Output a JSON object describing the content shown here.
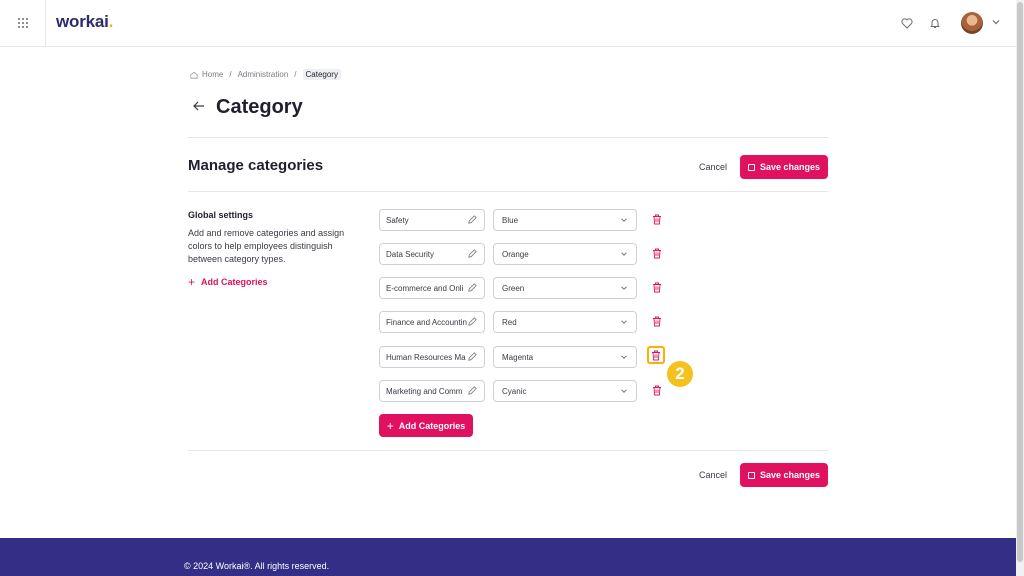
{
  "header": {
    "logo_text": "workai",
    "logo_dot": ".",
    "icons": [
      "apps-grid-icon",
      "heart-icon",
      "bell-icon",
      "avatar",
      "chevron-down-icon"
    ]
  },
  "breadcrumb": {
    "items": [
      "Home",
      "Administration",
      "Category"
    ]
  },
  "page": {
    "title": "Category"
  },
  "manage": {
    "title": "Manage categories",
    "cancel_label": "Cancel",
    "save_label": "Save changes"
  },
  "global_settings": {
    "title": "Global settings",
    "description": "Add and remove categories and assign colors to help employees distinguish between category types.",
    "add_label": "Add Categories"
  },
  "categories": [
    {
      "name": "Safety",
      "color": "Blue"
    },
    {
      "name": "Data Security",
      "color": "Orange"
    },
    {
      "name": "E-commerce and Onli",
      "color": "Green"
    },
    {
      "name": "Finance and Accountin",
      "color": "Red"
    },
    {
      "name": "Human Resources Ma",
      "color": "Magenta"
    },
    {
      "name": "Marketing and Comm",
      "color": "Cyanic"
    }
  ],
  "add_button_label": "Add Categories",
  "step_badge": "2",
  "footer": {
    "copyright": "© 2024 Workai®. All rights reserved."
  },
  "colors": {
    "accent": "#e0115f",
    "brand": "#2d2a6e",
    "footer": "#342f86",
    "highlight": "#f5b400"
  }
}
